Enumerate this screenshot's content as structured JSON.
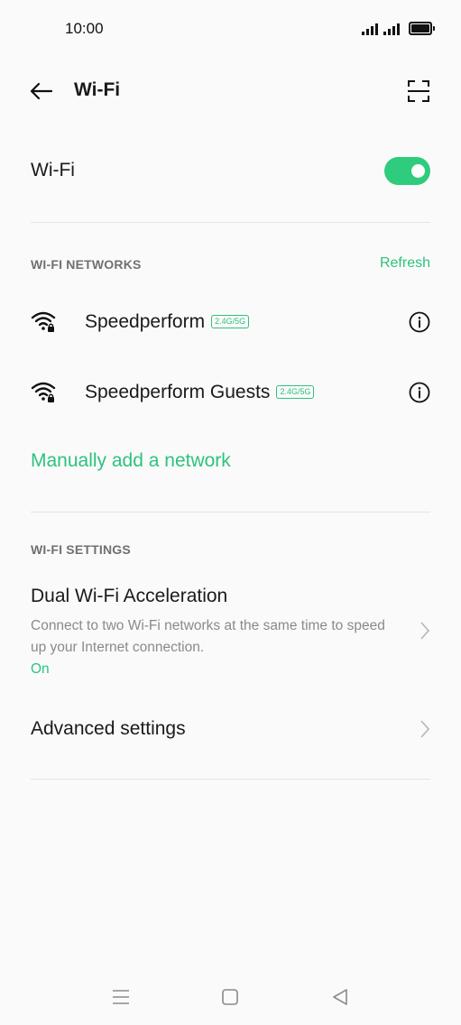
{
  "status_bar": {
    "time": "10:00",
    "icons": [
      "signal-icon",
      "signal-icon",
      "battery-icon"
    ]
  },
  "header": {
    "title": "Wi-Fi",
    "back_icon": "back-arrow-icon",
    "scan_icon": "scan-qr-icon"
  },
  "wifi_toggle": {
    "label": "Wi-Fi",
    "enabled": true,
    "accent": "#2ecc7c"
  },
  "networks_section": {
    "title": "WI-FI NETWORKS",
    "refresh_label": "Refresh",
    "networks": [
      {
        "name": "Speedperform",
        "band": "2.4G/5G",
        "secured": true
      },
      {
        "name": "Speedperform Guests",
        "band": "2.4G/5G",
        "secured": true
      }
    ],
    "manual_add_label": "Manually add a network"
  },
  "settings_section": {
    "title": "WI-FI SETTINGS",
    "dual": {
      "title": "Dual Wi-Fi Acceleration",
      "description": "Connect to two Wi-Fi networks at the same time to speed up your Internet connection.",
      "state": "On"
    },
    "advanced_label": "Advanced settings"
  },
  "navbar": {
    "icons": [
      "menu-icon",
      "home-icon",
      "back-triangle-icon"
    ]
  }
}
